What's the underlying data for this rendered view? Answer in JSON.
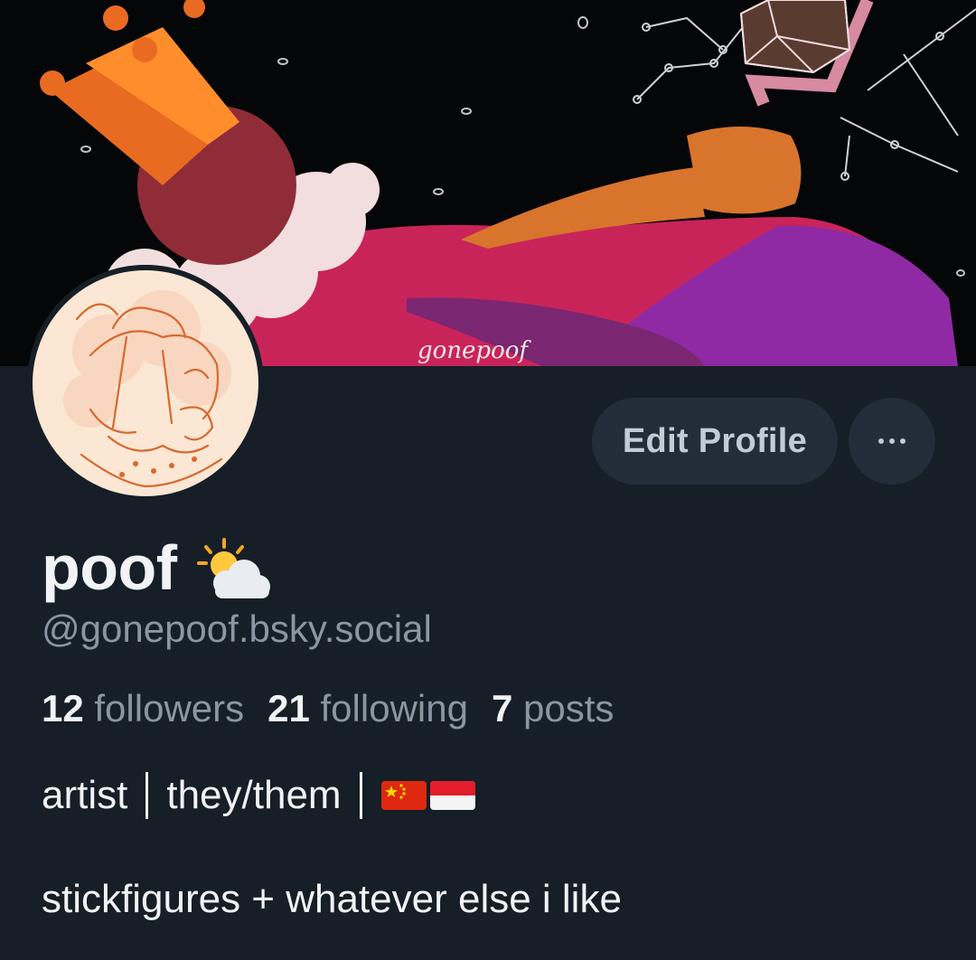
{
  "profile": {
    "banner_signature": "gonepoof",
    "display_name": "poof",
    "display_name_emoji": "sun-behind-cloud-icon",
    "handle": "@gonepoof.bsky.social"
  },
  "actions": {
    "edit_profile_label": "Edit Profile",
    "more_icon": "ellipsis-icon"
  },
  "stats": {
    "followers_count": "12",
    "followers_label": "followers",
    "following_count": "21",
    "following_label": "following",
    "posts_count": "7",
    "posts_label": "posts"
  },
  "bio": {
    "part1": "artist",
    "part2": "they/them",
    "flags": [
      "china-flag-icon",
      "indonesia-flag-icon"
    ],
    "line2": "stickfigures + whatever else i like"
  },
  "colors": {
    "background": "#161e27",
    "button_bg": "#222d39",
    "muted_text": "#8a96a3",
    "primary_text": "#f1f3f5"
  }
}
